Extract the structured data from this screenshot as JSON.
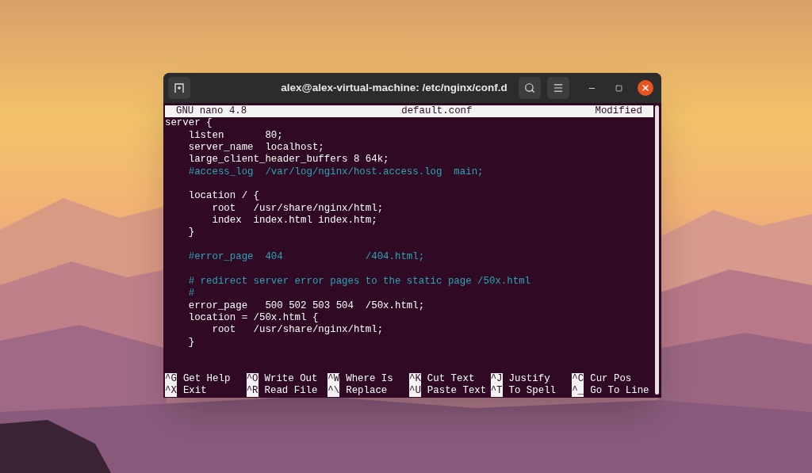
{
  "window": {
    "title": "alex@alex-virtual-machine: /etc/nginx/conf.d"
  },
  "nano_header": {
    "version": "GNU nano 4.8",
    "filename": "default.conf",
    "status": "Modified"
  },
  "lines": [
    {
      "kind": "code",
      "text": "server {"
    },
    {
      "kind": "code",
      "text": "    listen       80;"
    },
    {
      "kind": "code",
      "text": "    server_name  localhost;"
    },
    {
      "kind": "code",
      "text": "    large_client_header_buffers 8 64k;"
    },
    {
      "kind": "comment",
      "text": "    #access_log  /var/log/nginx/host.access.log  main;"
    },
    {
      "kind": "blank"
    },
    {
      "kind": "code",
      "text": "    location / {"
    },
    {
      "kind": "code",
      "text": "        root   /usr/share/nginx/html;"
    },
    {
      "kind": "code",
      "text": "        index  index.html index.htm;"
    },
    {
      "kind": "code",
      "text": "    }"
    },
    {
      "kind": "blank"
    },
    {
      "kind": "comment",
      "text": "    #error_page  404              /404.html;"
    },
    {
      "kind": "blank"
    },
    {
      "kind": "comment",
      "text": "    # redirect server error pages to the static page /50x.html"
    },
    {
      "kind": "comment",
      "text": "    #"
    },
    {
      "kind": "code",
      "text": "    error_page   500 502 503 504  /50x.html;"
    },
    {
      "kind": "code",
      "text": "    location = /50x.html {"
    },
    {
      "kind": "code",
      "text": "        root   /usr/share/nginx/html;"
    },
    {
      "kind": "code",
      "text": "    }"
    }
  ],
  "shortcuts": [
    {
      "key": "^G",
      "label": "Get Help"
    },
    {
      "key": "^O",
      "label": "Write Out"
    },
    {
      "key": "^W",
      "label": "Where Is"
    },
    {
      "key": "^K",
      "label": "Cut Text"
    },
    {
      "key": "^J",
      "label": "Justify"
    },
    {
      "key": "^C",
      "label": "Cur Pos"
    },
    {
      "key": "^X",
      "label": "Exit"
    },
    {
      "key": "^R",
      "label": "Read File"
    },
    {
      "key": "^\\",
      "label": "Replace"
    },
    {
      "key": "^U",
      "label": "Paste Text"
    },
    {
      "key": "^T",
      "label": "To Spell"
    },
    {
      "key": "^_",
      "label": "Go To Line"
    }
  ]
}
